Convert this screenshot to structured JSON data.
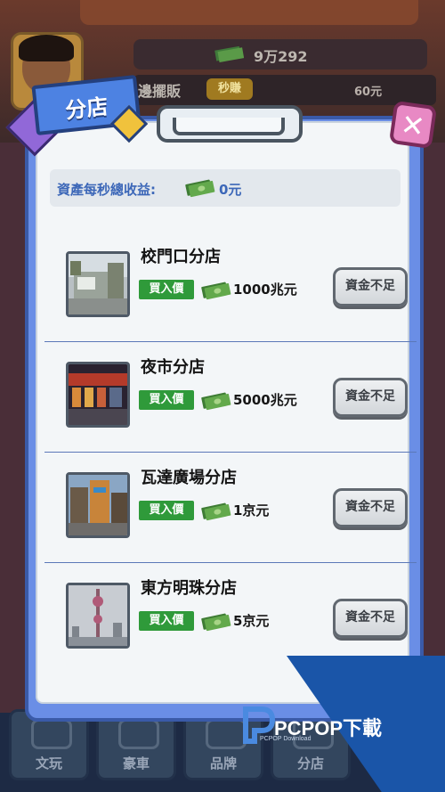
{
  "background": {
    "money_total": "9万292",
    "stall_label": "邊擺販",
    "per_sec_tag": "秒賺",
    "stall_price": "60元",
    "bottom_tabs": [
      "文玩",
      "豪車",
      "品牌",
      "分店"
    ]
  },
  "panel": {
    "ribbon_title": "分店",
    "close_symbol": "✕",
    "income_label": "資產每秒總收益:",
    "income_value": "0元"
  },
  "branches": [
    {
      "name": "校門口分店",
      "buy_label": "買入價",
      "price": "1000兆元",
      "button": "資金不足",
      "thumb": "school-gate-photo"
    },
    {
      "name": "夜市分店",
      "buy_label": "買入價",
      "price": "5000兆元",
      "button": "資金不足",
      "thumb": "night-market-photo"
    },
    {
      "name": "瓦達廣場分店",
      "buy_label": "買入價",
      "price": "1京元",
      "button": "資金不足",
      "thumb": "plaza-photo"
    },
    {
      "name": "東方明珠分店",
      "buy_label": "買入價",
      "price": "5京元",
      "button": "資金不足",
      "thumb": "oriental-pearl-tower-photo"
    }
  ],
  "watermark": {
    "brand": "PCPOP下載",
    "sub": "PCPOP Download"
  },
  "colors": {
    "panel": "#6a8ee6",
    "ribbon": "#4d82e2",
    "buy_tag": "#2f9a3a",
    "income_text": "#3c67b8"
  }
}
